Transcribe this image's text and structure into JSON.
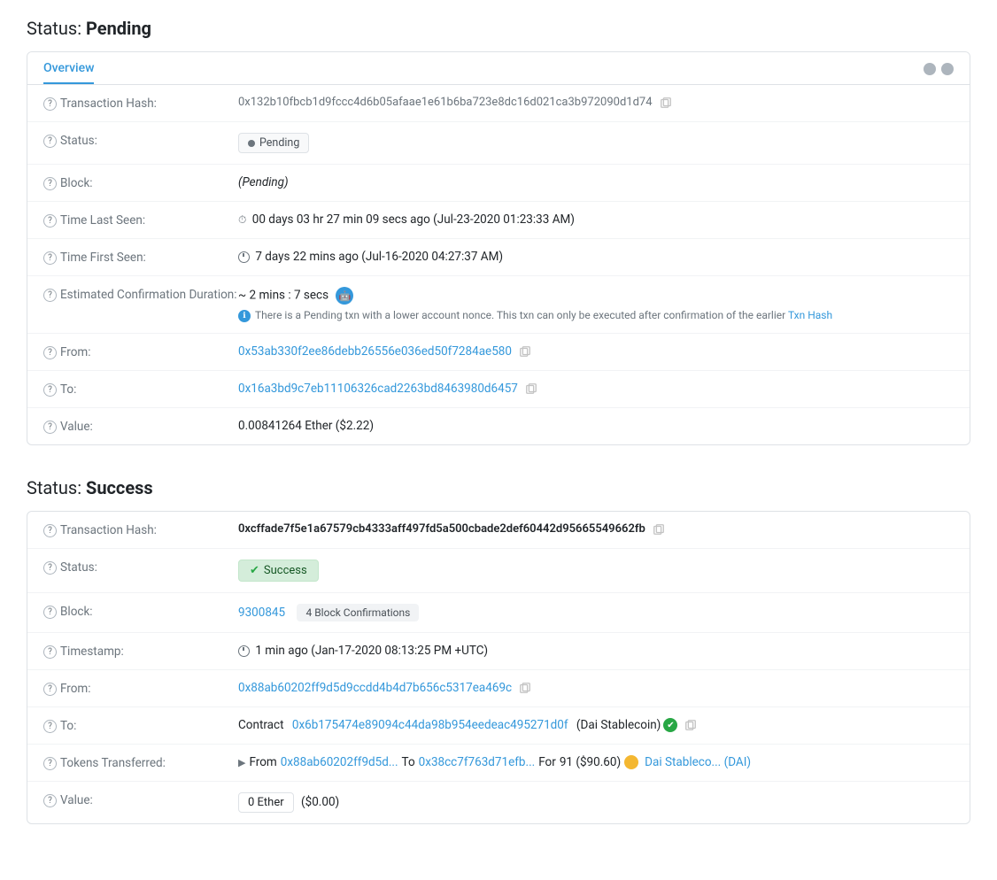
{
  "pending_section": {
    "title": "Status:",
    "title_bold": "Pending",
    "tab": "Overview",
    "dots": [
      "dot1",
      "dot2"
    ],
    "rows": {
      "transaction_hash": {
        "label": "Transaction Hash:",
        "value": "0x132b10fbcb1d9fccc4d6b05afaae1e61b6ba723e8dc16d021ca3b972090d1d74"
      },
      "status": {
        "label": "Status:",
        "badge": "Pending"
      },
      "block": {
        "label": "Block:",
        "value": "(Pending)"
      },
      "time_last_seen": {
        "label": "Time Last Seen:",
        "value": "00 days 03 hr 27 min 09 secs ago (Jul-23-2020 01:23:33 AM)"
      },
      "time_first_seen": {
        "label": "Time First Seen:",
        "value": "7 days 22 mins ago (Jul-16-2020 04:27:37 AM)"
      },
      "est_confirmation": {
        "label": "Estimated Confirmation Duration:",
        "value": "~ 2 mins : 7 secs",
        "warning": "There is a Pending txn with a lower account nonce. This txn can only be executed after confirmation of the earlier",
        "warning_link": "Txn Hash"
      },
      "from": {
        "label": "From:",
        "value": "0x53ab330f2ee86debb26556e036ed50f7284ae580"
      },
      "to": {
        "label": "To:",
        "value": "0x16a3bd9c7eb11106326cad2263bd8463980d6457"
      },
      "value": {
        "label": "Value:",
        "value": "0.00841264 Ether ($2.22)"
      }
    }
  },
  "success_section": {
    "title": "Status:",
    "title_bold": "Success",
    "rows": {
      "transaction_hash": {
        "label": "Transaction Hash:",
        "value": "0xcffade7f5e1a67579cb4333aff497fd5a500cbade2def60442d95665549662fb"
      },
      "status": {
        "label": "Status:",
        "badge": "Success"
      },
      "block": {
        "label": "Block:",
        "number": "9300845",
        "confirmations": "4 Block Confirmations"
      },
      "timestamp": {
        "label": "Timestamp:",
        "value": "1 min ago (Jan-17-2020 08:13:25 PM +UTC)"
      },
      "from": {
        "label": "From:",
        "value": "0x88ab60202ff9d5d9ccdd4b4d7b656c5317ea469c"
      },
      "to": {
        "label": "To:",
        "prefix": "Contract",
        "contract_address": "0x6b175474e89094c44da98b954eedeac495271d0f",
        "contract_name": "(Dai Stablecoin)"
      },
      "tokens_transferred": {
        "label": "Tokens Transferred:",
        "from_addr": "0x88ab60202ff9d5d...",
        "to_addr": "0x38cc7f763d71efb...",
        "amount": "91 ($90.60)",
        "token_name": "Dai Stableco... (DAI)"
      },
      "value": {
        "label": "Value:",
        "box": "0 Ether",
        "usd": "($0.00)"
      }
    }
  }
}
